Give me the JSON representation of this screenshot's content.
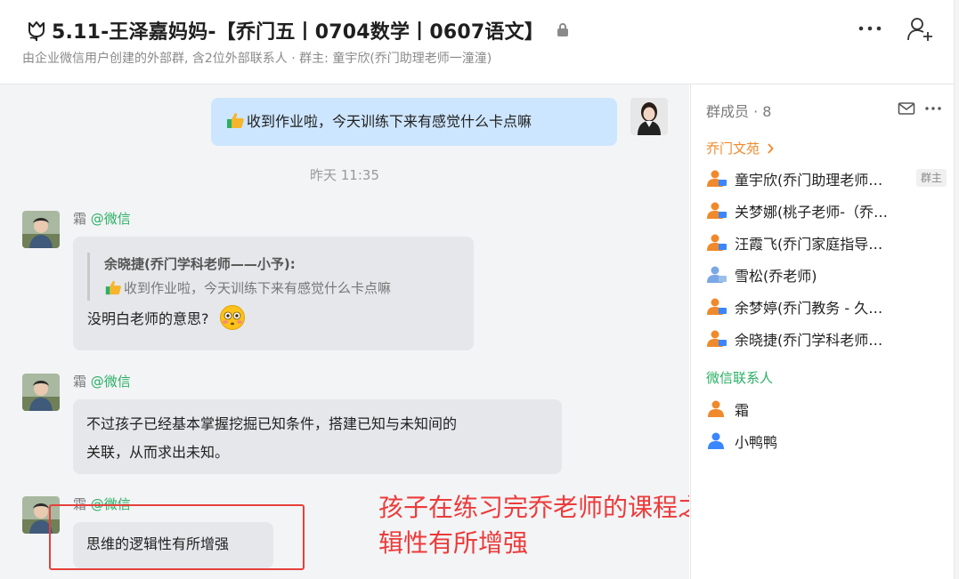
{
  "header": {
    "title": "5.11-王泽嘉妈妈-【乔门五丨0704数学丨0607语文】",
    "subtitle": "由企业微信用户创建的外部群, 含2位外部联系人 · 群主: 童宇欣(乔门助理老师一潼潼)",
    "title_icon": "tulip-icon",
    "lock_icon": "lock-icon"
  },
  "chat": {
    "messages": [
      {
        "side": "self",
        "text": "收到作业啦，今天训练下来有感觉什么卡点嘛",
        "leading_emoji": "thumbs-up-icon"
      }
    ],
    "timestamp": "昨天 11:35",
    "m2": {
      "sender_name": "霜",
      "sender_source": "@微信",
      "quote_name": "余晓捷(乔门学科老师——小予):",
      "quote_text": "收到作业啦，今天训练下来有感觉什么卡点嘛",
      "text": "没明白老师的意思?",
      "trailing_emoji": "flushed-face-icon"
    },
    "m3": {
      "sender_name": "霜",
      "sender_source": "@微信",
      "line1": "不过孩子已经基本掌握挖掘已知条件，搭建已知与未知间的",
      "line2": "关联，从而求出未知。"
    },
    "m4": {
      "sender_name": "霜",
      "sender_source": "@微信",
      "text": "思维的逻辑性有所增强"
    }
  },
  "annotation": {
    "line1": "孩子在练习完乔老师的课程之后，思维的逻",
    "line2": "辑性有所增强",
    "color": "#ec3b3b"
  },
  "sidebar": {
    "title": "群成员 · 8",
    "qimen_label": "乔门文苑",
    "wechat_label": "微信联系人",
    "owner_badge": "群主",
    "qimen_members": [
      "童宇欣(乔门助理老师一潼潼)",
      "关梦娜(桃子老师-（乔门书院)",
      "汪霞飞(乔门家庭指导师-霞飞)",
      "雪松(乔老师)",
      "余梦婷(乔门教务 - 久久老师)",
      "余晓捷(乔门学科老师——小予)"
    ],
    "wechat_members": [
      "霜",
      "小鸭鸭"
    ]
  },
  "colors": {
    "self_bubble": "#cde6ff",
    "other_bubble": "#e6e7ea",
    "source_green": "#2bb065",
    "qimen_orange": "#f0892b",
    "wechat_blue": "#3a86ff"
  }
}
